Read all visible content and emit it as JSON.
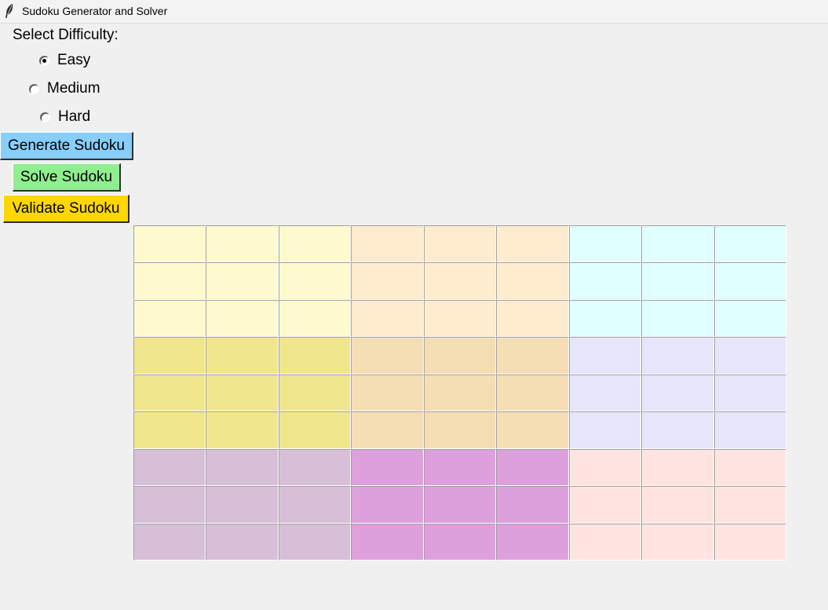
{
  "window": {
    "title": "Sudoku Generator and Solver",
    "icon": "feather-icon"
  },
  "difficulty": {
    "label": "Select Difficulty:",
    "options": [
      {
        "label": "Easy",
        "selected": true
      },
      {
        "label": "Medium",
        "selected": false
      },
      {
        "label": "Hard",
        "selected": false
      }
    ]
  },
  "buttons": {
    "generate": {
      "label": "Generate Sudoku",
      "color": "#87cefa"
    },
    "solve": {
      "label": "Solve Sudoku",
      "color": "#90ee90"
    },
    "validate": {
      "label": "Validate Sudoku",
      "color": "#ffd700"
    }
  },
  "grid": {
    "box_colors": [
      [
        "#fffacd",
        "#ffebcd",
        "#e0ffff"
      ],
      [
        "#f0e68c",
        "#f5deb3",
        "#e6e6fa"
      ],
      [
        "#d8bfd8",
        "#dda0dd",
        "#ffe4e1"
      ]
    ],
    "cells": [
      [
        "",
        "",
        "",
        "",
        "",
        "",
        "",
        "",
        ""
      ],
      [
        "",
        "",
        "",
        "",
        "",
        "",
        "",
        "",
        ""
      ],
      [
        "",
        "",
        "",
        "",
        "",
        "",
        "",
        "",
        ""
      ],
      [
        "",
        "",
        "",
        "",
        "",
        "",
        "",
        "",
        ""
      ],
      [
        "",
        "",
        "",
        "",
        "",
        "",
        "",
        "",
        ""
      ],
      [
        "",
        "",
        "",
        "",
        "",
        "",
        "",
        "",
        ""
      ],
      [
        "",
        "",
        "",
        "",
        "",
        "",
        "",
        "",
        ""
      ],
      [
        "",
        "",
        "",
        "",
        "",
        "",
        "",
        "",
        ""
      ],
      [
        "",
        "",
        "",
        "",
        "",
        "",
        "",
        "",
        ""
      ]
    ]
  }
}
